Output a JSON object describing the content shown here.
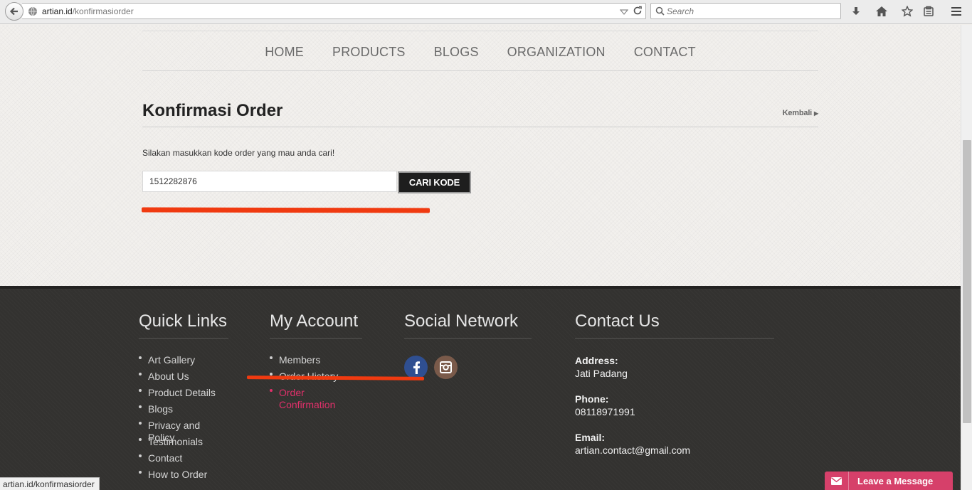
{
  "browser": {
    "url_domain": "artian.id",
    "url_path": "/konfirmasiorder",
    "search_placeholder": "Search",
    "status_url": "artian.id/konfirmasiorder"
  },
  "nav": {
    "items": [
      "HOME",
      "PRODUCTS",
      "BLOGS",
      "ORGANIZATION",
      "CONTACT"
    ]
  },
  "main": {
    "title": "Konfirmasi Order",
    "back_label": "Kembali",
    "instruction": "Silakan masukkan kode order yang mau anda cari!",
    "code_value": "1512282876",
    "search_button": "CARI KODE"
  },
  "footer": {
    "quick_links": {
      "title": "Quick Links",
      "items": [
        "Art Gallery",
        "About Us",
        "Product Details",
        "Blogs",
        "Privacy and Policy",
        "Testimonials",
        "Contact",
        "How to Order"
      ]
    },
    "my_account": {
      "title": "My Account",
      "items": [
        "Members",
        "Order History",
        "Order Confirmation"
      ]
    },
    "social": {
      "title": "Social Network",
      "icons": [
        "facebook-icon",
        "instagram-icon"
      ]
    },
    "contact": {
      "title": "Contact Us",
      "address_label": "Address:",
      "address": "Jati Padang",
      "phone_label": "Phone:",
      "phone": "08118971991",
      "email_label": "Email:",
      "email": "artian.contact@gmail.com"
    }
  },
  "chat": {
    "label": "Leave a Message"
  },
  "colors": {
    "accent_pink": "#e0306a",
    "highlight_red": "#f03a10",
    "footer_bg": "#333230"
  }
}
